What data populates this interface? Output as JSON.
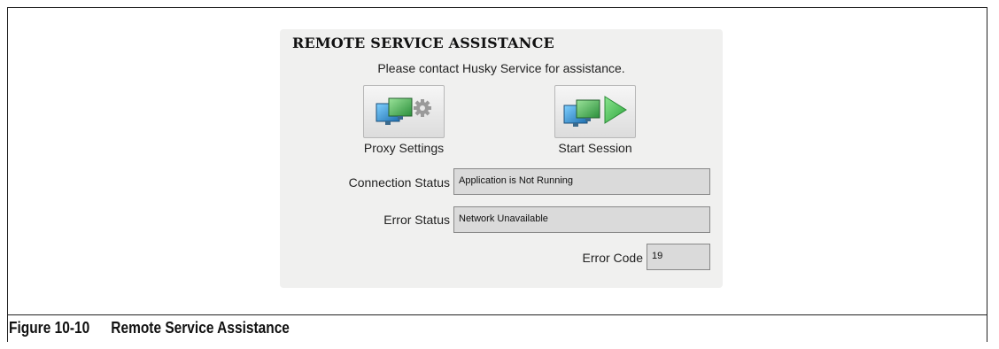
{
  "panel": {
    "title": "REMOTE SERVICE ASSISTANCE",
    "subtitle": "Please contact Husky Service for assistance."
  },
  "buttons": {
    "proxy_settings": {
      "label": "Proxy Settings",
      "icon": "monitors-gear-icon"
    },
    "start_session": {
      "label": "Start Session",
      "icon": "monitors-play-icon"
    }
  },
  "status": {
    "connection_label": "Connection Status",
    "connection_value": "Application is Not Running",
    "error_label": "Error Status",
    "error_value": "Network Unavailable",
    "code_label": "Error Code",
    "code_value": "19"
  },
  "figure": {
    "number": "Figure 10-10",
    "title": "Remote Service Assistance"
  },
  "colors": {
    "panel_bg": "#f0f0ef",
    "field_bg": "#dadada",
    "monitor_blue": "#2a7fc0",
    "monitor_green": "#3fb04a",
    "play_green": "#4cc25a"
  }
}
